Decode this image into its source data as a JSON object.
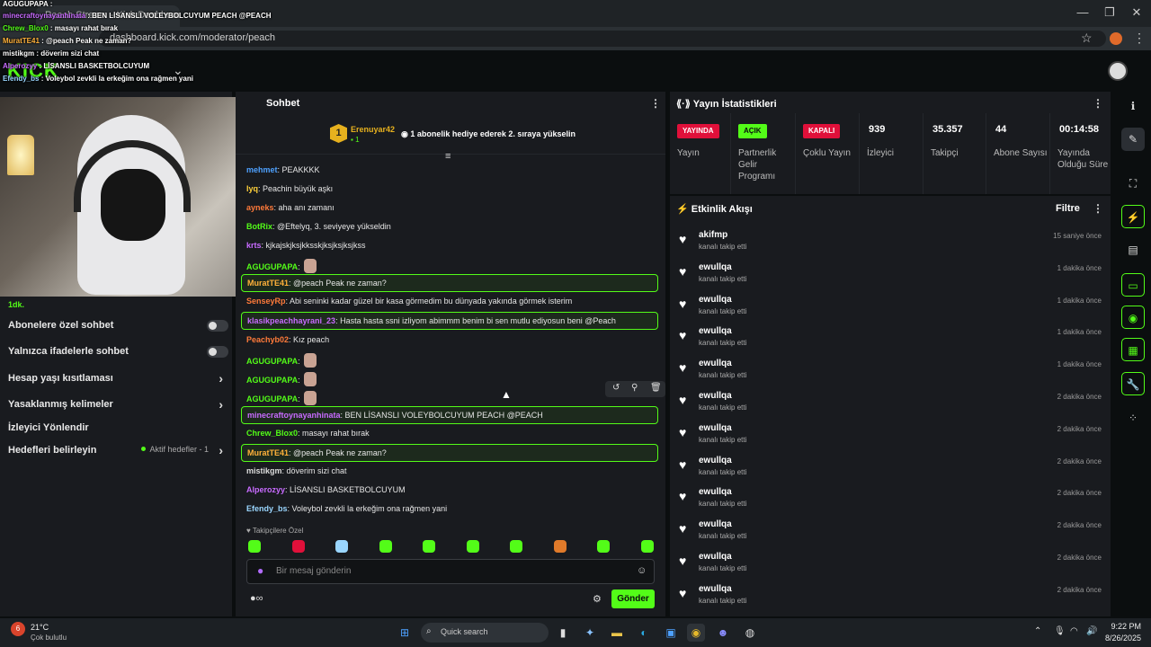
{
  "browser": {
    "tab_title": "Peach Stream - Kick Dashboard",
    "url": "dashboard.kick.com/moderator/peach"
  },
  "kick": {
    "logo": "KICK"
  },
  "overlay_chat": [
    {
      "user": "AGUGUPAPA",
      "text": ""
    },
    {
      "user": "minecraftoynayanhinata",
      "text": "BEN LİSANSLI VOLEYBOLCUYUM PEACH @PEACH"
    },
    {
      "user": "Chrew_Blox0",
      "text": "masayı rahat bırak"
    },
    {
      "user": "MuratTE41",
      "text": "@peach Peak ne zaman?"
    },
    {
      "user": "mistikgm",
      "text": "döverim sizi chat"
    },
    {
      "user": "Alperozyy",
      "text": "LİSANSLI BASKETBOLCUYUM"
    },
    {
      "user": "Efendy_bs",
      "text": "Voleybol zevkli la erkeğim ona rağmen yani"
    }
  ],
  "settings": {
    "partial": "1dk.",
    "subs_only": "Abonelere özel sohbet",
    "emote_only": "Yalnızca ifadelerle sohbet",
    "age_restrict": "Hesap yaşı kısıtlaması",
    "banned_words": "Yasaklanmış kelimeler",
    "viewer_guide": "İzleyici Yönlendir",
    "goals": "Hedefleri belirleyin",
    "active_goals": "Aktif hedefler - 1"
  },
  "chat": {
    "title": "Sohbet",
    "goal_user": "Erenuyar42",
    "goal_count": "1",
    "goal_badge": "1",
    "goal_text": "1 abonelik hediye ederek 2. sıraya yükselin",
    "followers_only": "Takipçilere Özel",
    "input_placeholder": "Bir mesaj gönderin",
    "send": "Gönder",
    "messages": [
      {
        "user": "mehmet",
        "text": "PEAKKKK",
        "color": "#4ea1ff"
      },
      {
        "user": "lyq",
        "text": "Peachin büyük aşkı",
        "color": "#ffd13a"
      },
      {
        "user": "ayneks",
        "text": "aha anı zamanı",
        "color": "#ff7a3a"
      },
      {
        "user": "BotRix",
        "text": "@Eftelyq, 3. seviyeye yükseldin",
        "color": "#53fc18"
      },
      {
        "user": "krts",
        "text": "kjkajskjksjkksskjksjksjksjkss",
        "color": "#c86bff"
      },
      {
        "user": "AGUGUPAPA",
        "text": "",
        "color": "#53fc18"
      },
      {
        "user": "MuratTE41",
        "text": "@peach Peak ne zaman?",
        "color": "#ffb13a"
      },
      {
        "user": "SenseyRp",
        "text": "Abi seninki kadar güzel bir kasa görmedim bu dünyada yakında görmek isterim",
        "color": "#ff7a3a"
      },
      {
        "user": "klasikpeachhayrani_23",
        "text": "Hasta hasta ssni izliyom abimmm benim bi sen mutlu ediyosun beni @Peach",
        "color": "#c86bff"
      },
      {
        "user": "Peachyb02",
        "text": "Kız peach",
        "color": "#ff7a3a"
      },
      {
        "user": "AGUGUPAPA",
        "text": "",
        "color": "#53fc18"
      },
      {
        "user": "AGUGUPAPA",
        "text": "",
        "color": "#53fc18"
      },
      {
        "user": "AGUGUPAPA",
        "text": "",
        "color": "#53fc18"
      },
      {
        "user": "minecraftoynayanhinata",
        "text": "BEN LİSANSLI VOLEYBOLCUYUM PEACH @PEACH",
        "color": "#c86bff"
      },
      {
        "user": "Chrew_Blox0",
        "text": "masayı rahat bırak",
        "color": "#53fc18"
      },
      {
        "user": "MuratTE41",
        "text": "@peach Peak ne zaman?",
        "color": "#ffb13a"
      },
      {
        "user": "mistikgm",
        "text": "döverim sizi chat",
        "color": "#ddd"
      },
      {
        "user": "Alperozyy",
        "text": "LİSANSLI BASKETBOLCUYUM",
        "color": "#c86bff"
      },
      {
        "user": "Efendy_bs",
        "text": "Voleybol zevkli la erkeğim ona rağmen yani",
        "color": "#9ad6ff"
      }
    ]
  },
  "stats": {
    "title": "Yayın İstatistikleri",
    "cells": [
      {
        "pill": "YAYINDA",
        "label": "Yayın"
      },
      {
        "pill": "AÇIK",
        "label": "Partnerlik Gelir Programı"
      },
      {
        "pill": "KAPALI",
        "label": "Çoklu Yayın"
      },
      {
        "value": "939",
        "label": "İzleyici"
      },
      {
        "value": "35.357",
        "label": "Takipçi"
      },
      {
        "value": "44",
        "label": "Abone Sayısı"
      },
      {
        "value": "00:14:58",
        "label": "Yayında Olduğu Süre"
      }
    ],
    "colors": {
      "live": "#e0103a",
      "on": "#53fc18",
      "off": "#e0103a"
    }
  },
  "activity": {
    "title": "Etkinlik Akışı",
    "filter": "Filtre",
    "items": [
      {
        "user": "akifmp",
        "sub": "kanalı takip etti",
        "time": "15 saniye önce"
      },
      {
        "user": "ewullqa",
        "sub": "kanalı takip etti",
        "time": "1 dakika önce"
      },
      {
        "user": "ewullqa",
        "sub": "kanalı takip etti",
        "time": "1 dakika önce"
      },
      {
        "user": "ewullqa",
        "sub": "kanalı takip etti",
        "time": "1 dakika önce"
      },
      {
        "user": "ewullqa",
        "sub": "kanalı takip etti",
        "time": "1 dakika önce"
      },
      {
        "user": "ewullqa",
        "sub": "kanalı takip etti",
        "time": "2 dakika önce"
      },
      {
        "user": "ewullqa",
        "sub": "kanalı takip etti",
        "time": "2 dakika önce"
      },
      {
        "user": "ewullqa",
        "sub": "kanalı takip etti",
        "time": "2 dakika önce"
      },
      {
        "user": "ewullqa",
        "sub": "kanalı takip etti",
        "time": "2 dakika önce"
      },
      {
        "user": "ewullqa",
        "sub": "kanalı takip etti",
        "time": "2 dakika önce"
      },
      {
        "user": "ewullqa",
        "sub": "kanalı takip etti",
        "time": "2 dakika önce"
      },
      {
        "user": "ewullqa",
        "sub": "kanalı takip etti",
        "time": "2 dakika önce"
      }
    ]
  },
  "taskbar": {
    "weather_temp": "21°C",
    "weather_desc": "Çok bulutlu",
    "weather_badge": "6",
    "search": "Quick search",
    "time": "9:22 PM",
    "date": "8/26/2025"
  }
}
